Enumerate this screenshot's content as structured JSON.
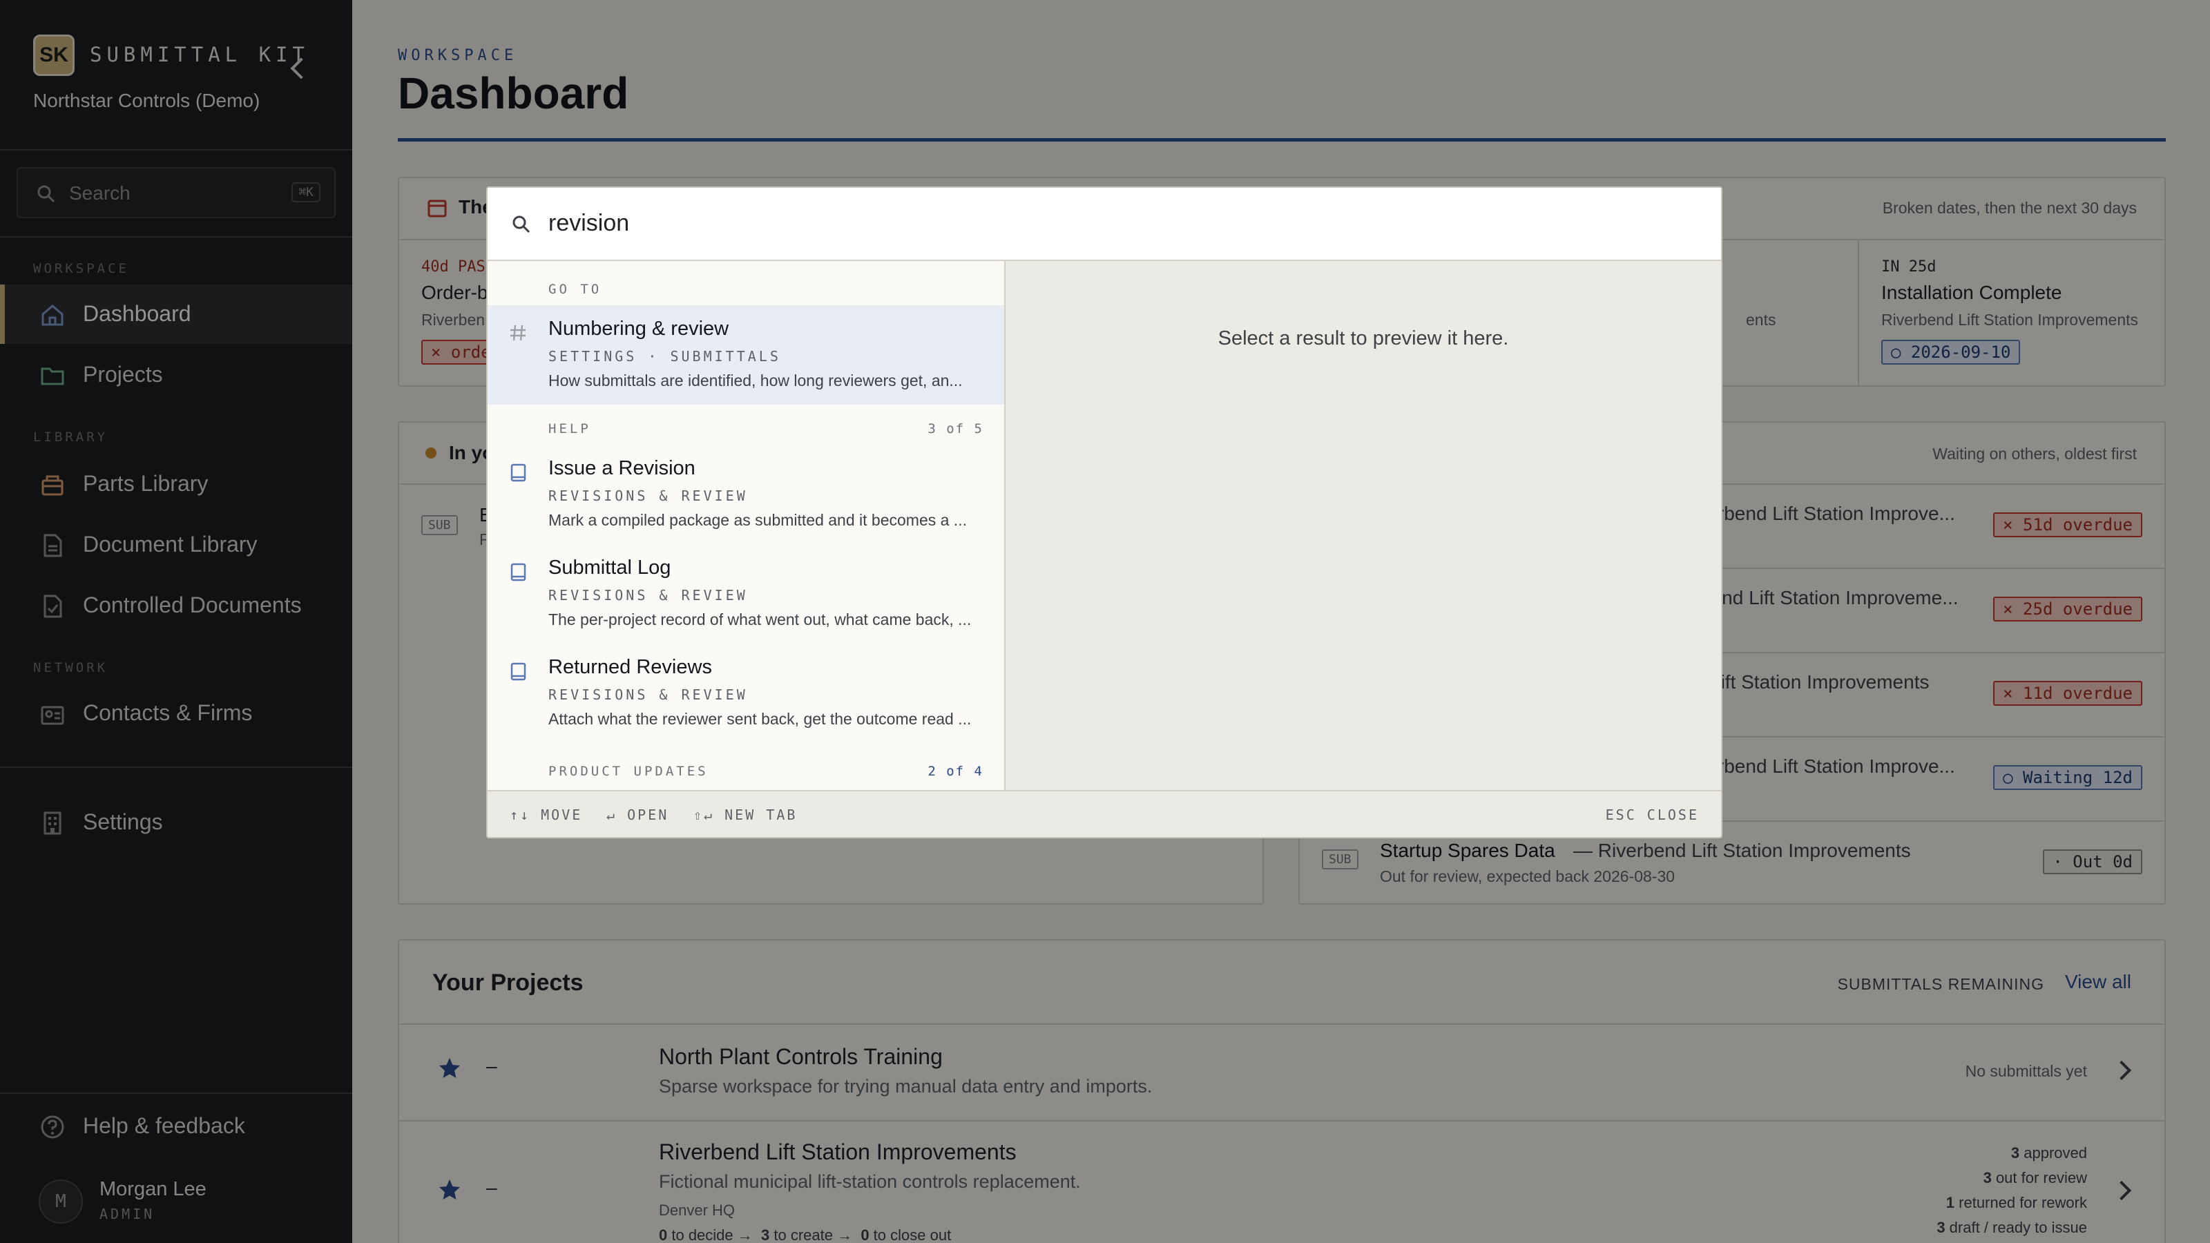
{
  "sidebar": {
    "logo": "SK",
    "brand": "SUBMITTAL KIT",
    "org": "Northstar Controls (Demo)",
    "search_placeholder": "Search",
    "search_shortcut": "⌘K",
    "sections": {
      "workspace": "WORKSPACE",
      "library": "LIBRARY",
      "network": "NETWORK"
    },
    "items": {
      "dashboard": "Dashboard",
      "projects": "Projects",
      "parts": "Parts Library",
      "documents": "Document Library",
      "controlled": "Controlled Documents",
      "contacts": "Contacts & Firms",
      "settings": "Settings",
      "help": "Help & feedback"
    },
    "user": {
      "initial": "M",
      "name": "Morgan Lee",
      "role": "ADMIN"
    }
  },
  "header": {
    "eyebrow": "WORKSPACE",
    "title": "Dashboard"
  },
  "dates_card": {
    "title_partial": "The",
    "subtitle": "Broken dates, then the next 30 days",
    "left": {
      "when": "40d PAS",
      "title": "Order-b",
      "project": "Riverben",
      "tag": "× orde"
    },
    "mid_partial": "ents",
    "right": {
      "when": "IN 25d",
      "title": "Installation Complete",
      "project": "Riverbend Lift Station Improvements",
      "tag": "○ 2026-09-10"
    }
  },
  "queue_card": {
    "title_partial": "In yo",
    "left_row": {
      "tag": "SUB",
      "title": "E",
      "sub": "F"
    }
  },
  "waiting_card": {
    "subtitle": "Waiting on others, oldest first",
    "rows": [
      {
        "title": "rerbend Lift Station Improve...",
        "tag": "× 51d overdue",
        "kind": "red"
      },
      {
        "title": "bend Lift Station Improveme...",
        "tag": "× 25d overdue",
        "kind": "red"
      },
      {
        "title": "l Lift Station Improvements",
        "tag": "× 11d overdue",
        "kind": "red"
      },
      {
        "title": "rerbend Lift Station Improve...",
        "tag": "○ Waiting 12d",
        "kind": "blue"
      }
    ],
    "last": {
      "tag": "SUB",
      "title": "Startup Spares Data",
      "project": " — Riverbend Lift Station Improvements",
      "sub": "Out for review, expected back 2026-08-30",
      "badge": "· Out 0d"
    }
  },
  "projects": {
    "title": "Your Projects",
    "col": "SUBMITTALS REMAINING",
    "view_all": "View all",
    "rows": [
      {
        "dash": "–",
        "name": "North Plant Controls Training",
        "desc": "Sparse workspace for trying manual data entry and imports.",
        "status": "No submittals yet"
      },
      {
        "dash": "–",
        "name": "Riverbend Lift Station Improvements",
        "desc": "Fictional municipal lift-station controls replacement.",
        "loc": "Denver HQ",
        "flow": {
          "a": "0",
          "a_l": " to decide",
          "b": "3",
          "b_l": " to create",
          "c": "0",
          "c_l": " to close out"
        },
        "stats": [
          {
            "n": "3",
            "l": " approved"
          },
          {
            "n": "3",
            "l": " out for review"
          },
          {
            "n": "1",
            "l": " returned for rework"
          },
          {
            "n": "3",
            "l": " draft / ready to issue"
          }
        ]
      }
    ]
  },
  "palette": {
    "query": "revision",
    "preview_hint": "Select a result to preview it here.",
    "groups": {
      "goto": "GO TO",
      "help": "HELP",
      "help_count": "3 of 5",
      "updates": "PRODUCT UPDATES",
      "updates_count": "2 of 4"
    },
    "results": [
      {
        "title": "Numbering & review",
        "crumb": "SETTINGS · SUBMITTALS",
        "desc": "How submittals are identified, how long reviewers get, an..."
      },
      {
        "title": "Issue a Revision",
        "crumb": "REVISIONS & REVIEW",
        "desc": "Mark a compiled package as submitted and it becomes a ..."
      },
      {
        "title": "Submittal Log",
        "crumb": "REVISIONS & REVIEW",
        "desc": "The per-project record of what went out, what came back, ..."
      },
      {
        "title": "Returned Reviews",
        "crumb": "REVISIONS & REVIEW",
        "desc": "Attach what the reviewer sent back, get the outcome read ..."
      }
    ],
    "footer": {
      "move": "↑↓ MOVE",
      "open": "↵ OPEN",
      "newtab": "⇧↵ NEW TAB",
      "close": "ESC CLOSE"
    }
  }
}
